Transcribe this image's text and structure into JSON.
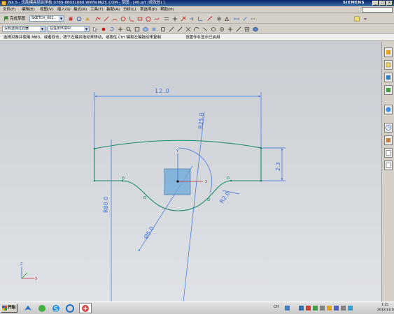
{
  "window": {
    "title": "NX 5 - 优胜模具培训学校  0769-88031060  WWW.MJZC.COM - 草图 - [40.prt (修改的) ]",
    "brand": "SIEMENS",
    "controls": [
      "_",
      "□",
      "×"
    ]
  },
  "menu": {
    "items": [
      "文件(F)",
      "编辑(E)",
      "视图(V)",
      "插入(S)",
      "格式(R)",
      "工具(T)",
      "装配(A)",
      "分析(L)",
      "首选项(P)",
      "帮助(H)"
    ]
  },
  "toolbar1": {
    "finish_sketch_label": "完成草图",
    "sketch_name": "SKETCH_001"
  },
  "toolbar2": {
    "selection_filter": "没有选择过滤器",
    "selection_scope": "在任务环境中"
  },
  "cue": {
    "prompt": "选择对象并使用 MB3，或者双击，按下左键并拖动来移动，或按住 Ctrl 键和左键拖动来复制",
    "status": "设置作业显示已启用"
  },
  "sketch": {
    "dimensions": {
      "width": "12.0",
      "height": "2.3",
      "radius_top": "R25.0",
      "radius_left": "R80.0",
      "radius_right": "R2.0",
      "diameter": "Ø5.0"
    },
    "axis_labels": {
      "x": "X",
      "y": "Y",
      "z": "Z"
    }
  },
  "taskbar": {
    "start_label": "开始",
    "language": "CH",
    "time": "1:25",
    "date": "2012/11/16"
  },
  "colors": {
    "sketch_curve": "#1a8a6a",
    "dimension": "#3a6fd8",
    "selection_box": "#6aa8d8",
    "title_bar": "#0a246a"
  }
}
